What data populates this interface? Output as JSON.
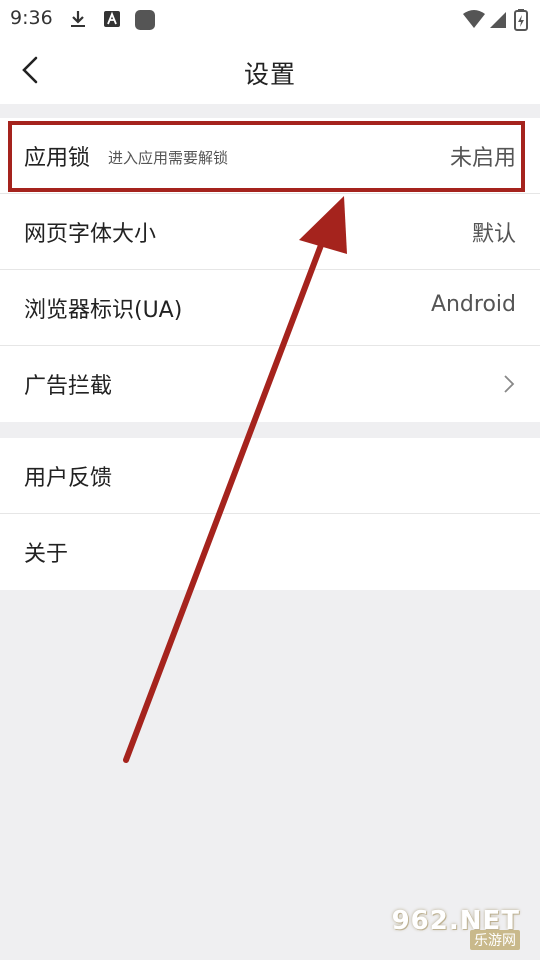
{
  "status_bar": {
    "time": "9:36",
    "icons": [
      "download-icon",
      "keyboard-a-icon",
      "app-square-icon",
      "wifi-icon",
      "signal-icon",
      "battery-icon"
    ]
  },
  "header": {
    "title": "设置",
    "back_icon": "chevron-left-icon"
  },
  "settings_group_1": [
    {
      "label": "应用锁",
      "subtitle": "进入应用需要解锁",
      "value": "未启用"
    },
    {
      "label": "网页字体大小",
      "value": "默认"
    },
    {
      "label": "浏览器标识(UA)",
      "value": "Android"
    },
    {
      "label": "广告拦截",
      "icon": "chevron-right-icon"
    }
  ],
  "settings_group_2": [
    {
      "label": "用户反馈"
    },
    {
      "label": "关于"
    }
  ],
  "annotation": {
    "color": "#a5231d"
  },
  "watermark": {
    "text": "962.NET",
    "subtext": "乐游网"
  },
  "colors": {
    "background": "#efeff1",
    "surface": "#ffffff",
    "text_primary": "#222222",
    "text_secondary": "#555555",
    "divider": "#e6e6e6"
  }
}
